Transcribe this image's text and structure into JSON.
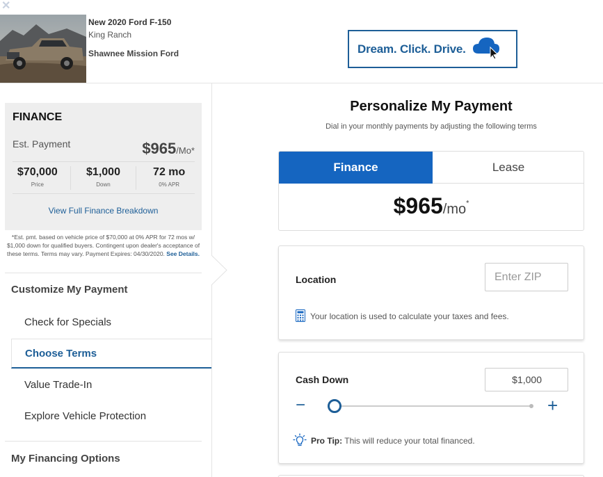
{
  "header": {
    "close_glyph": "✕",
    "vehicle_title": "New 2020 Ford F-150",
    "vehicle_trim": "King Ranch",
    "dealer": "Shawnee Mission Ford",
    "logo_text": "Dream. Click. Drive."
  },
  "finance_card": {
    "heading": "FINANCE",
    "est_label": "Est. Payment",
    "est_value": "$965",
    "est_unit": "/Mo*",
    "stats": [
      {
        "value": "$70,000",
        "label": "Price"
      },
      {
        "value": "$1,000",
        "label": "Down"
      },
      {
        "value": "72 mo",
        "label": "0% APR"
      }
    ],
    "breakdown_link": "View Full Finance Breakdown"
  },
  "disclaimer": {
    "text": "*Est. pmt. based on vehicle price of $70,000 at 0% APR for 72 mos w/ $1,000 down for qualified buyers. Contingent upon dealer's acceptance of these terms. Terms may vary. Payment Expires: 04/30/2020.",
    "link": "See Details."
  },
  "sidebar": {
    "section_customize": "Customize My Payment",
    "items": [
      {
        "label": "Check for Specials"
      },
      {
        "label": "Choose Terms"
      },
      {
        "label": "Value Trade-In"
      },
      {
        "label": "Explore Vehicle Protection"
      }
    ],
    "active_index": 1,
    "section_financing": "My Financing Options"
  },
  "main": {
    "title": "Personalize My Payment",
    "subtitle": "Dial in your monthly payments by adjusting the following terms",
    "tabs": [
      {
        "label": "Finance",
        "active": true
      },
      {
        "label": "Lease",
        "active": false
      }
    ],
    "payment_value": "$965",
    "payment_unit": "/mo",
    "payment_mark": "*",
    "location": {
      "label": "Location",
      "zip_placeholder": "Enter ZIP",
      "zip_value": "",
      "note": "Your location is used to calculate your taxes and fees."
    },
    "cash_down": {
      "label": "Cash Down",
      "value": "$1,000",
      "slider_fraction": 0.0,
      "minus_glyph": "−",
      "plus_glyph": "+",
      "protip_label": "Pro Tip:",
      "protip_text": " This will reduce your total financed."
    }
  },
  "colors": {
    "accent": "#1565c0",
    "link": "#1d5e97",
    "card_bg": "#eeeeee"
  }
}
